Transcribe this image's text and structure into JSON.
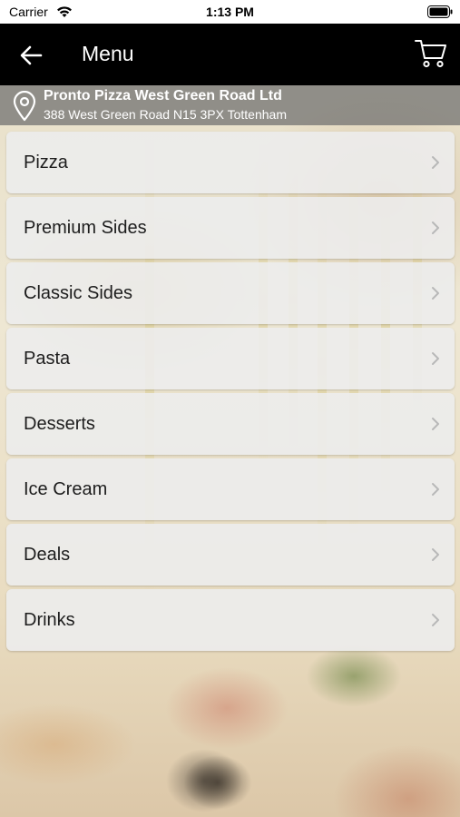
{
  "status_bar": {
    "carrier": "Carrier",
    "time": "1:13 PM",
    "wifi_icon": "wifi-icon",
    "battery_icon": "battery-icon"
  },
  "nav": {
    "title": "Menu",
    "back_icon": "arrow-left-icon",
    "cart_icon": "cart-icon",
    "background": "#000000"
  },
  "location": {
    "name": "Pronto Pizza West Green Road Ltd",
    "address": "388 West Green Road N15 3PX Tottenham",
    "icon": "map-pin-icon"
  },
  "menu": {
    "items": [
      {
        "label": "Pizza"
      },
      {
        "label": "Premium Sides"
      },
      {
        "label": "Classic Sides"
      },
      {
        "label": "Pasta"
      },
      {
        "label": "Desserts"
      },
      {
        "label": "Ice Cream"
      },
      {
        "label": "Deals"
      },
      {
        "label": "Drinks"
      }
    ],
    "chevron_icon": "chevron-right-icon"
  }
}
